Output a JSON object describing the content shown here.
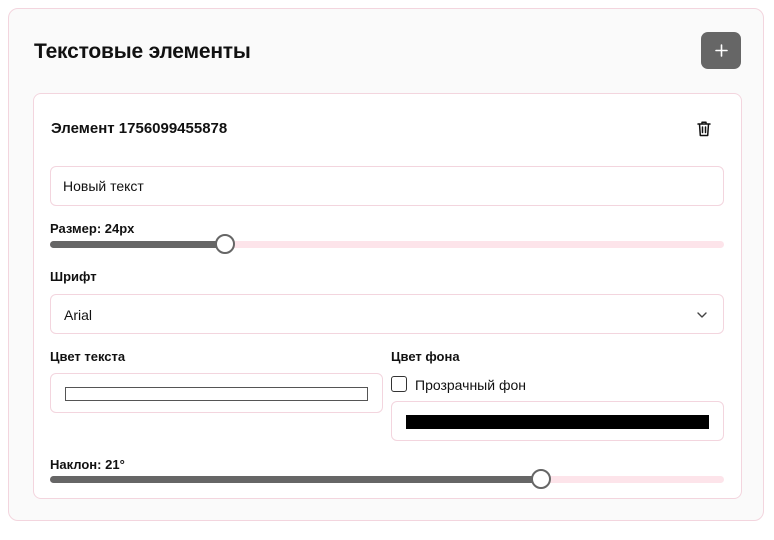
{
  "panel": {
    "title": "Текстовые элементы",
    "add_icon": "plus-icon"
  },
  "element": {
    "name": "Элемент 1756099455878",
    "delete_icon": "trash-icon",
    "text_value": "Новый текст",
    "size_label": "Размер: 24px",
    "size_slider_fraction": 0.258,
    "font_label": "Шрифт",
    "font_value": "Arial",
    "text_color_label": "Цвет текста",
    "text_color": "#ffffff",
    "bg_color_label": "Цвет фона",
    "transparent_bg_label": "Прозрачный фон",
    "transparent_bg_checked": false,
    "bg_color": "#000000",
    "skew_label": "Наклон: 21°",
    "skew_slider_fraction": 0.727
  },
  "colors": {
    "accent": "#666666",
    "border": "#f3d5de",
    "track": "#fde4ea"
  }
}
